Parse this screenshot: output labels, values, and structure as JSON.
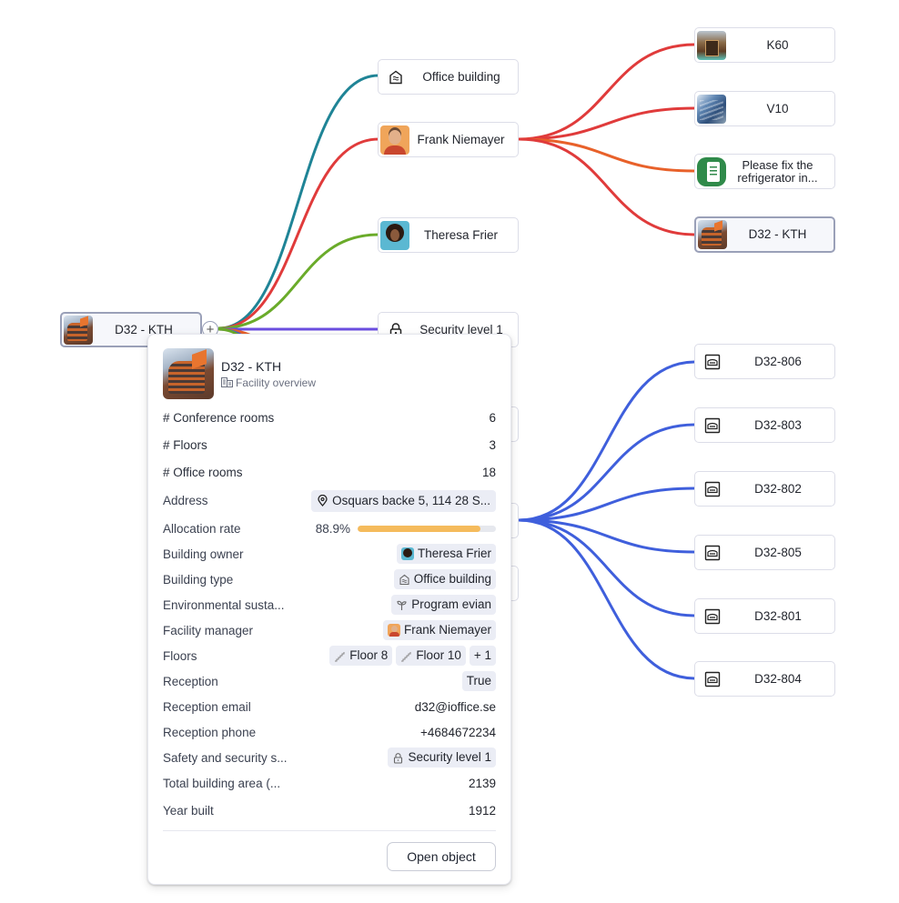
{
  "colors": {
    "edge_teal": "#1f8496",
    "edge_red": "#e03b3b",
    "edge_green": "#6aab2a",
    "edge_purple": "#6b4fe0",
    "edge_orange": "#e8612a",
    "edge_blue": "#3f5fdc",
    "progress_fill": "#f5bb5c",
    "link": "#2a48e8"
  },
  "graph": {
    "root": {
      "label": "D32 - KTH",
      "thumb": "building-photo",
      "expand_icon": "plus-icon"
    },
    "level1": [
      {
        "id": "office-building",
        "label": "Office building",
        "icon": "office-building-icon"
      },
      {
        "id": "frank",
        "label": "Frank Niemayer",
        "thumb": "avatar-frank"
      },
      {
        "id": "theresa",
        "label": "Theresa Frier",
        "thumb": "avatar-theresa"
      },
      {
        "id": "security",
        "label": "Security level 1",
        "icon": "lock-icon"
      }
    ],
    "frank_children": [
      {
        "label": "K60",
        "thumb": "building-photo-k60"
      },
      {
        "label": "V10",
        "thumb": "building-photo-v10"
      },
      {
        "label": "Please fix the refrigerator in...",
        "thumb": "task-clipboard-icon"
      },
      {
        "label": "D32 - KTH",
        "thumb": "building-photo",
        "selected": true
      }
    ],
    "rooms": [
      {
        "label": "D32-806",
        "icon": "room-icon"
      },
      {
        "label": "D32-803",
        "icon": "room-icon"
      },
      {
        "label": "D32-802",
        "icon": "room-icon"
      },
      {
        "label": "D32-805",
        "icon": "room-icon"
      },
      {
        "label": "D32-801",
        "icon": "room-icon"
      },
      {
        "label": "D32-804",
        "icon": "room-icon"
      }
    ]
  },
  "popup": {
    "title": "D32 - KTH",
    "subtitle": "Facility overview",
    "rows": {
      "conference_rooms": {
        "label": "# Conference rooms",
        "value": "6"
      },
      "floors_count": {
        "label": "# Floors",
        "value": "3"
      },
      "office_rooms": {
        "label": "# Office rooms",
        "value": "18"
      },
      "address": {
        "label": "Address",
        "value": "Osquars backe 5, 114 28 S..."
      },
      "allocation_rate": {
        "label": "Allocation rate",
        "value": "88.9%",
        "fraction": 0.889
      },
      "building_owner": {
        "label": "Building owner",
        "value": "Theresa Frier"
      },
      "building_type": {
        "label": "Building type",
        "value": "Office building"
      },
      "environmental": {
        "label": "Environmental susta...",
        "value": "Program evian"
      },
      "facility_manager": {
        "label": "Facility manager",
        "value": "Frank Niemayer"
      },
      "floors": {
        "label": "Floors",
        "chips": [
          "Floor 8",
          "Floor 10"
        ],
        "more": "+ 1"
      },
      "reception": {
        "label": "Reception",
        "value": "True"
      },
      "reception_email": {
        "label": "Reception email",
        "value": "d32@ioffice.se"
      },
      "reception_phone": {
        "label": "Reception phone",
        "value": "+4684672234"
      },
      "safety": {
        "label": "Safety and security s...",
        "value": "Security level 1"
      },
      "total_area": {
        "label": "Total building area (...",
        "value": "2139"
      },
      "year_built": {
        "label": "Year built",
        "value": "1912"
      }
    },
    "open_button": "Open object"
  }
}
